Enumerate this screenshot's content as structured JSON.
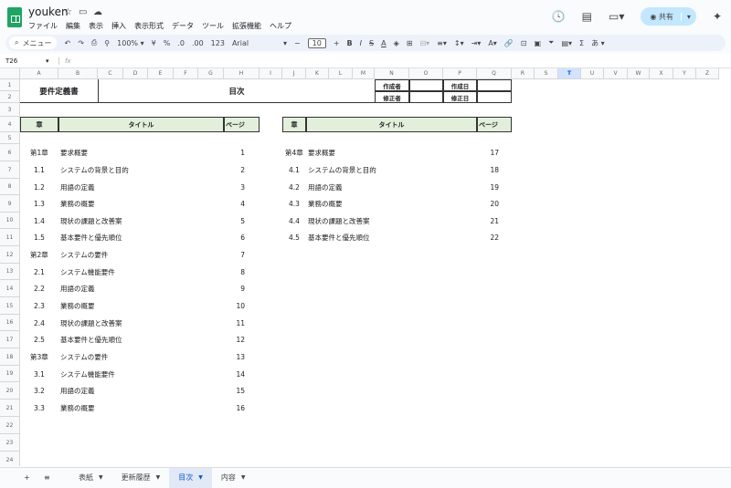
{
  "app": {
    "title": "youken",
    "menu": [
      "ファイル",
      "編集",
      "表示",
      "挿入",
      "表示形式",
      "データ",
      "ツール",
      "拡張機能",
      "ヘルプ"
    ],
    "share_label": "共有"
  },
  "toolbar": {
    "search_label": "メニュー",
    "zoom": "100%",
    "currency": "¥",
    "percent": "%",
    "dec_dec": ".0",
    "dec_inc": ".00",
    "number_format": "123",
    "font": "Arial",
    "font_size": "10",
    "bold": "B",
    "italic": "I",
    "input_method": "あ"
  },
  "formula_bar": {
    "cell_ref": "T26",
    "fx": "fx",
    "value": ""
  },
  "columns": [
    "A",
    "B",
    "C",
    "D",
    "E",
    "F",
    "G",
    "H",
    "I",
    "J",
    "K",
    "L",
    "M",
    "N",
    "O",
    "P",
    "Q",
    "R",
    "S",
    "T",
    "U",
    "V",
    "W",
    "X",
    "Y",
    "Z"
  ],
  "selected_column": "T",
  "rows": [
    "1",
    "2",
    "3",
    "4",
    "5",
    "6",
    "7",
    "8",
    "9",
    "10",
    "11",
    "12",
    "13",
    "14",
    "15",
    "16",
    "17",
    "18",
    "19",
    "20",
    "21",
    "22",
    "23",
    "24"
  ],
  "doc": {
    "title": "要件定義書",
    "toc_title": "目次",
    "author_label": "作成者",
    "author": "",
    "created_label": "作成日",
    "created": "",
    "editor_label": "修正者",
    "editor": "",
    "modified_label": "修正日",
    "modified": ""
  },
  "toc_headers": {
    "chapter": "章",
    "title": "タイトル",
    "page": "ページ"
  },
  "toc_left": [
    {
      "no": "第1章",
      "title": "要求概要",
      "page": "1",
      "chapter": true
    },
    {
      "no": "1.1",
      "title": "システムの背景と目的",
      "page": "2"
    },
    {
      "no": "1.2",
      "title": "用語の定義",
      "page": "3"
    },
    {
      "no": "1.3",
      "title": "業務の概要",
      "page": "4"
    },
    {
      "no": "1.4",
      "title": "現状の課題と改善案",
      "page": "5"
    },
    {
      "no": "1.5",
      "title": "基本要件と優先順位",
      "page": "6"
    },
    {
      "no": "第2章",
      "title": "システムの要件",
      "page": "7",
      "chapter": true
    },
    {
      "no": "2.1",
      "title": "システム機能要件",
      "page": "8"
    },
    {
      "no": "2.2",
      "title": "用語の定義",
      "page": "9"
    },
    {
      "no": "2.3",
      "title": "業務の概要",
      "page": "10"
    },
    {
      "no": "2.4",
      "title": "現状の課題と改善案",
      "page": "11"
    },
    {
      "no": "2.5",
      "title": "基本要件と優先順位",
      "page": "12"
    },
    {
      "no": "第3章",
      "title": "システムの要件",
      "page": "13",
      "chapter": true
    },
    {
      "no": "3.1",
      "title": "システム機能要件",
      "page": "14"
    },
    {
      "no": "3.2",
      "title": "用語の定義",
      "page": "15"
    },
    {
      "no": "3.3",
      "title": "業務の概要",
      "page": "16"
    }
  ],
  "toc_right": [
    {
      "no": "第4章",
      "title": "要求概要",
      "page": "17",
      "chapter": true
    },
    {
      "no": "4.1",
      "title": "システムの背景と目的",
      "page": "18"
    },
    {
      "no": "4.2",
      "title": "用語の定義",
      "page": "19"
    },
    {
      "no": "4.3",
      "title": "業務の概要",
      "page": "20"
    },
    {
      "no": "4.4",
      "title": "現状の課題と改善案",
      "page": "21"
    },
    {
      "no": "4.5",
      "title": "基本要件と優先順位",
      "page": "22"
    }
  ],
  "sheet_tabs": [
    {
      "label": "表紙"
    },
    {
      "label": "更新履歴"
    },
    {
      "label": "目次",
      "active": true
    },
    {
      "label": "内容"
    }
  ],
  "colors": {
    "header_fill": "#e2efda",
    "accent": "#0b57d0",
    "share_bg": "#c2e7ff"
  }
}
